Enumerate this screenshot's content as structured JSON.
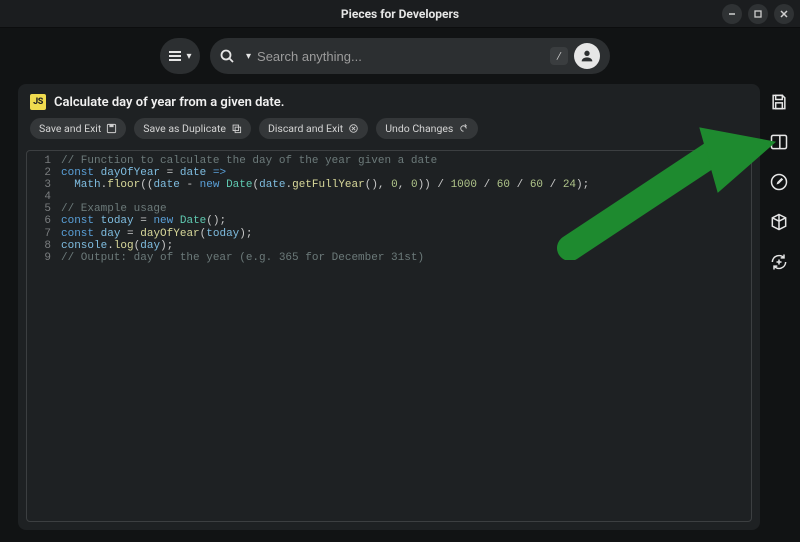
{
  "window": {
    "title": "Pieces for Developers"
  },
  "toolbar": {
    "search_placeholder": "Search anything...",
    "key_hint": "/"
  },
  "snippet": {
    "icon_label": "JS",
    "title": "Calculate day of year from a given date."
  },
  "chips": {
    "save_exit": "Save and Exit",
    "save_duplicate": "Save as Duplicate",
    "discard_exit": "Discard and Exit",
    "undo_changes": "Undo Changes"
  },
  "code": {
    "lines": [
      {
        "n": "1",
        "html": "<span class='c-cmt'>// Function to calculate the day of the year given a date</span>"
      },
      {
        "n": "2",
        "html": "<span class='c-kw'>const</span> <span class='c-id'>dayOfYear</span> = <span class='c-id'>date</span> <span class='c-kw'>=></span>"
      },
      {
        "n": "3",
        "html": "  <span class='c-id'>Math</span>.<span class='c-fn'>floor</span>((<span class='c-id'>date</span> - <span class='c-kw'>new</span> <span class='c-cls'>Date</span>(<span class='c-id'>date</span>.<span class='c-fn'>getFullYear</span>(), <span class='c-num'>0</span>, <span class='c-num'>0</span>)) / <span class='c-num'>1000</span> / <span class='c-num'>60</span> / <span class='c-num'>60</span> / <span class='c-num'>24</span>);"
      },
      {
        "n": "4",
        "html": ""
      },
      {
        "n": "5",
        "html": "<span class='c-cmt'>// Example usage</span>"
      },
      {
        "n": "6",
        "html": "<span class='c-kw'>const</span> <span class='c-id'>today</span> = <span class='c-kw'>new</span> <span class='c-cls'>Date</span>();"
      },
      {
        "n": "7",
        "html": "<span class='c-kw'>const</span> <span class='c-id'>day</span> = <span class='c-fn'>dayOfYear</span>(<span class='c-id'>today</span>);"
      },
      {
        "n": "8",
        "html": "<span class='c-id'>console</span>.<span class='c-fn'>log</span>(<span class='c-id'>day</span>);"
      },
      {
        "n": "9",
        "html": "<span class='c-cmt'>// Output: day of the year (e.g. 365 for December 31st)</span>"
      }
    ]
  },
  "arrow": {
    "color": "#1e8a2f"
  }
}
